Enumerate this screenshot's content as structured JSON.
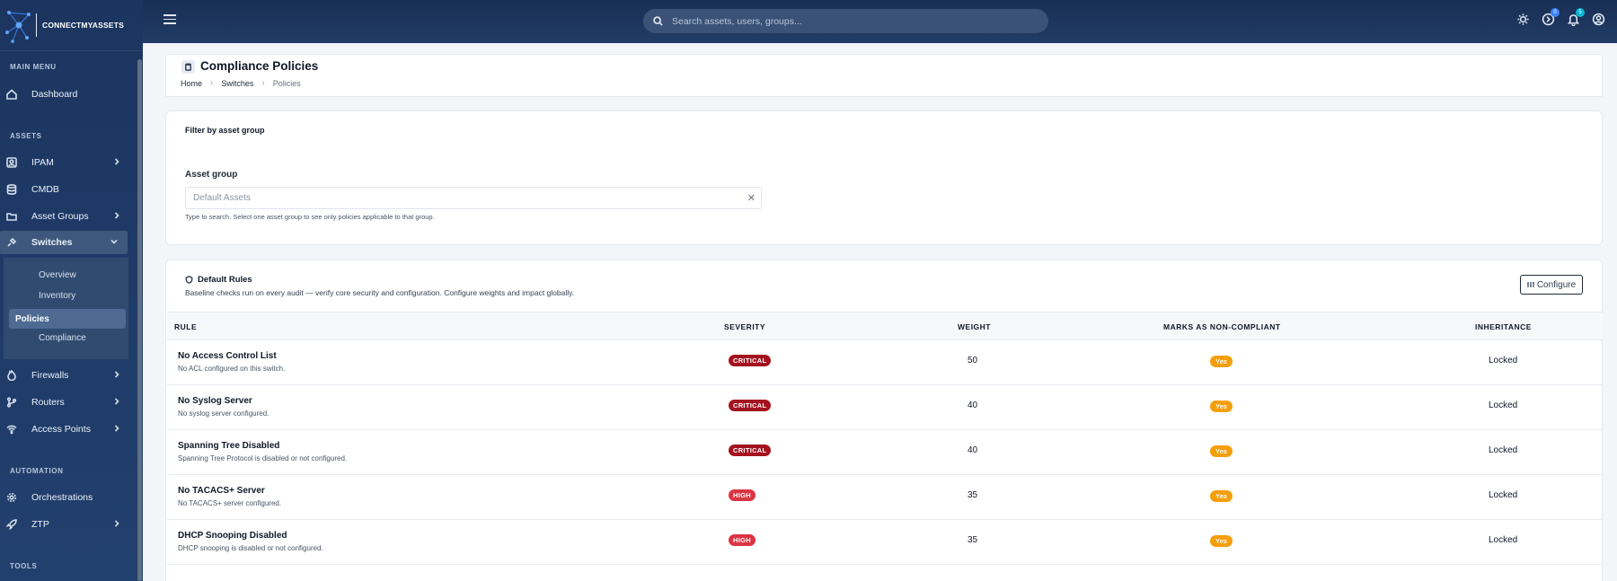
{
  "brand": {
    "name": "CONNECTMYASSETS"
  },
  "search": {
    "placeholder": "Search assets, users, groups..."
  },
  "topbar": {
    "badges": [
      "0",
      "5"
    ]
  },
  "sidebar": {
    "sections": [
      "MAIN MENU",
      "ASSETS",
      "AUTOMATION",
      "TOOLS"
    ],
    "items": [
      {
        "label": "Dashboard",
        "icon": "home-icon"
      },
      {
        "label": "IPAM",
        "icon": "ipam-icon"
      },
      {
        "label": "CMDB",
        "icon": "database-icon"
      },
      {
        "label": "Asset Groups",
        "icon": "folder-icon"
      },
      {
        "label": "Switches",
        "icon": "switch-icon"
      },
      {
        "label": "Firewalls",
        "icon": "firewall-icon"
      },
      {
        "label": "Routers",
        "icon": "router-icon"
      },
      {
        "label": "Access Points",
        "icon": "wifi-icon"
      },
      {
        "label": "Orchestrations",
        "icon": "gear-icon"
      },
      {
        "label": "ZTP",
        "icon": "rocket-icon"
      }
    ],
    "submenu": [
      "Overview",
      "Inventory",
      "Policies",
      "Compliance"
    ]
  },
  "page": {
    "title": "Compliance Policies",
    "breadcrumb": [
      "Home",
      "Switches",
      "Policies"
    ]
  },
  "filter": {
    "title": "Filter by asset group",
    "label": "Asset group",
    "value": "Default Assets",
    "help": "Type to search. Select one asset group to see only policies applicable to that group."
  },
  "rules": {
    "title": "Default Rules",
    "description": "Baseline checks run on every audit — verify core security and configuration. Configure weights and impact globally.",
    "configure_label": "Configure",
    "columns": [
      "RULE",
      "SEVERITY",
      "WEIGHT",
      "MARKS AS NON-COMPLIANT",
      "INHERITANCE"
    ],
    "rows": [
      {
        "name": "No Access Control List",
        "desc": "No ACL configured on this switch.",
        "severity": "CRITICAL",
        "weight": "50",
        "non_compliant": "Yes",
        "inheritance": "Locked"
      },
      {
        "name": "No Syslog Server",
        "desc": "No syslog server configured.",
        "severity": "CRITICAL",
        "weight": "40",
        "non_compliant": "Yes",
        "inheritance": "Locked"
      },
      {
        "name": "Spanning Tree Disabled",
        "desc": "Spanning Tree Protocol is disabled or not configured.",
        "severity": "CRITICAL",
        "weight": "40",
        "non_compliant": "Yes",
        "inheritance": "Locked"
      },
      {
        "name": "No TACACS+ Server",
        "desc": "No TACACS+ server configured.",
        "severity": "HIGH",
        "weight": "35",
        "non_compliant": "Yes",
        "inheritance": "Locked"
      },
      {
        "name": "DHCP Snooping Disabled",
        "desc": "DHCP snooping is disabled or not configured.",
        "severity": "HIGH",
        "weight": "35",
        "non_compliant": "Yes",
        "inheritance": "Locked"
      }
    ]
  },
  "colors": {
    "critical": "#a4121f",
    "high": "#db3443",
    "yes": "#f59e0b",
    "sidebar": "#1c3560"
  }
}
